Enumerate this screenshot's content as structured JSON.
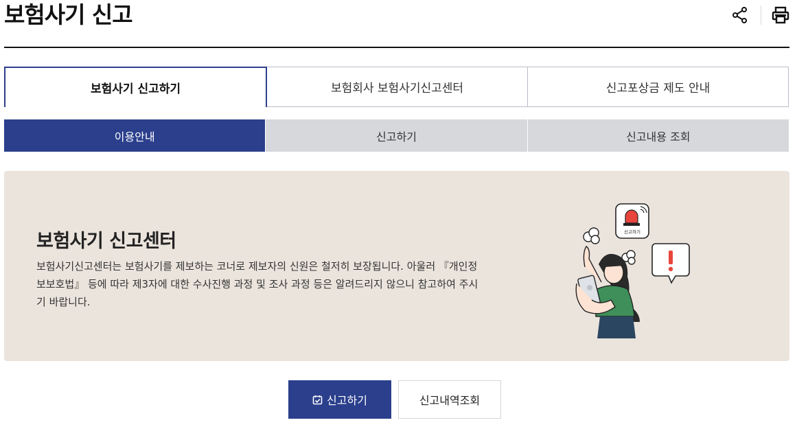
{
  "page": {
    "title": "보험사기 신고"
  },
  "header_tools": {
    "share_icon": "share-icon",
    "print_icon": "print-icon"
  },
  "tabs": [
    {
      "label": "보험사기 신고하기",
      "active": true
    },
    {
      "label": "보험회사 보험사기신고센터",
      "active": false
    },
    {
      "label": "신고포상금 제도 안내",
      "active": false
    }
  ],
  "subtabs": [
    {
      "label": "이용안내",
      "active": true
    },
    {
      "label": "신고하기",
      "active": false
    },
    {
      "label": "신고내용 조회",
      "active": false
    }
  ],
  "banner": {
    "title": "보험사기 신고센터",
    "description": "보험사기신고센터는 보험사기를 제보하는 코너로 제보자의 신원은 철저히 보장됩니다. 아울러 『개인정보보호법』 등에 따라 제3자에 대한 수사진행 과정 및 조사 과정 등은 알려드리지 않으니 참고하여 주시기 바랍니다.",
    "app_icon_label": "신고하기"
  },
  "actions": {
    "report_label": "신고하기",
    "history_label": "신고내역조회"
  },
  "colors": {
    "accent": "#2b3f8c",
    "subtab_inactive": "#d6d8dc",
    "banner_bg": "#ebe4dd"
  }
}
